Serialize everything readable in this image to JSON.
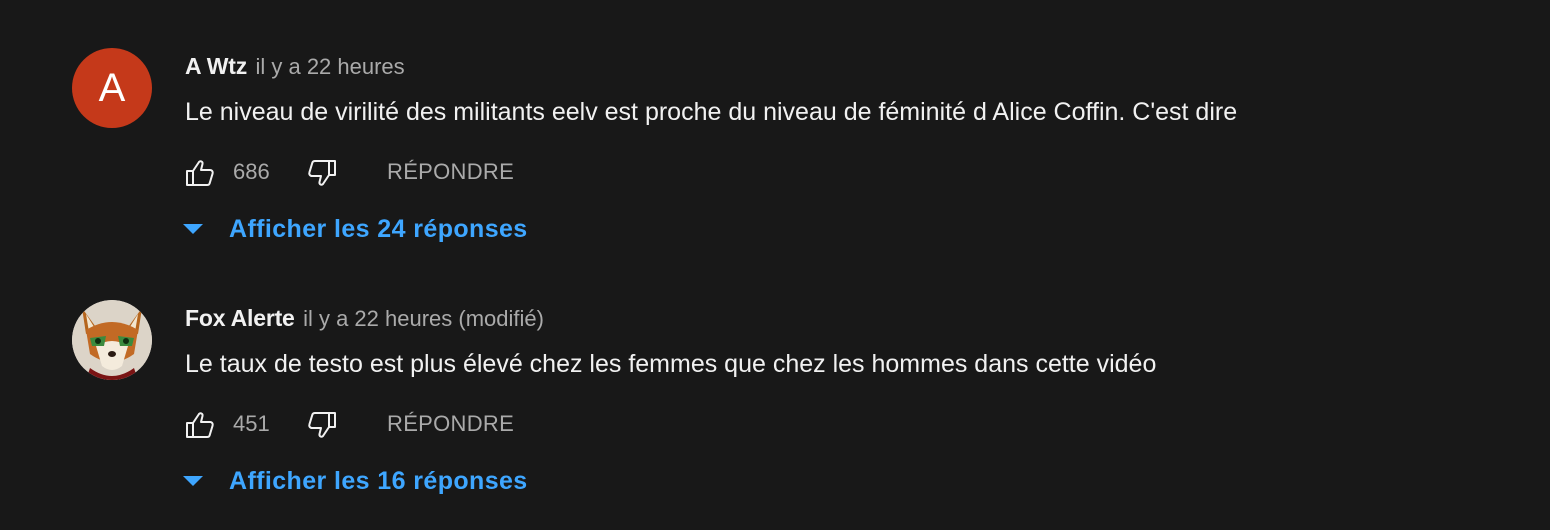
{
  "colors": {
    "background": "#181818",
    "text_primary": "#f1f1f1",
    "text_secondary": "#aaaaaa",
    "link_blue": "#3ea6ff",
    "avatar_a_bg": "#c5391a"
  },
  "comments": [
    {
      "avatar": {
        "type": "letter",
        "letter": "A"
      },
      "author": "A Wtz",
      "time": "il y a 22 heures",
      "text": "Le niveau de virilité des militants eelv est proche du niveau de féminité d Alice Coffin. C'est dire",
      "likes": "686",
      "like_icon": "thumb-up-icon",
      "dislike_icon": "thumb-down-icon",
      "reply_label": "RÉPONDRE",
      "replies_label": "Afficher les 24 réponses",
      "replies_icon": "caret-down-icon"
    },
    {
      "avatar": {
        "type": "image",
        "icon": "fox-avatar"
      },
      "author": "Fox Alerte",
      "time": "il y a 22 heures (modifié)",
      "text": "Le taux de testo est plus élevé chez les femmes que chez les hommes dans cette vidéo",
      "likes": "451",
      "like_icon": "thumb-up-icon",
      "dislike_icon": "thumb-down-icon",
      "reply_label": "RÉPONDRE",
      "replies_label": "Afficher les 16 réponses",
      "replies_icon": "caret-down-icon"
    }
  ]
}
